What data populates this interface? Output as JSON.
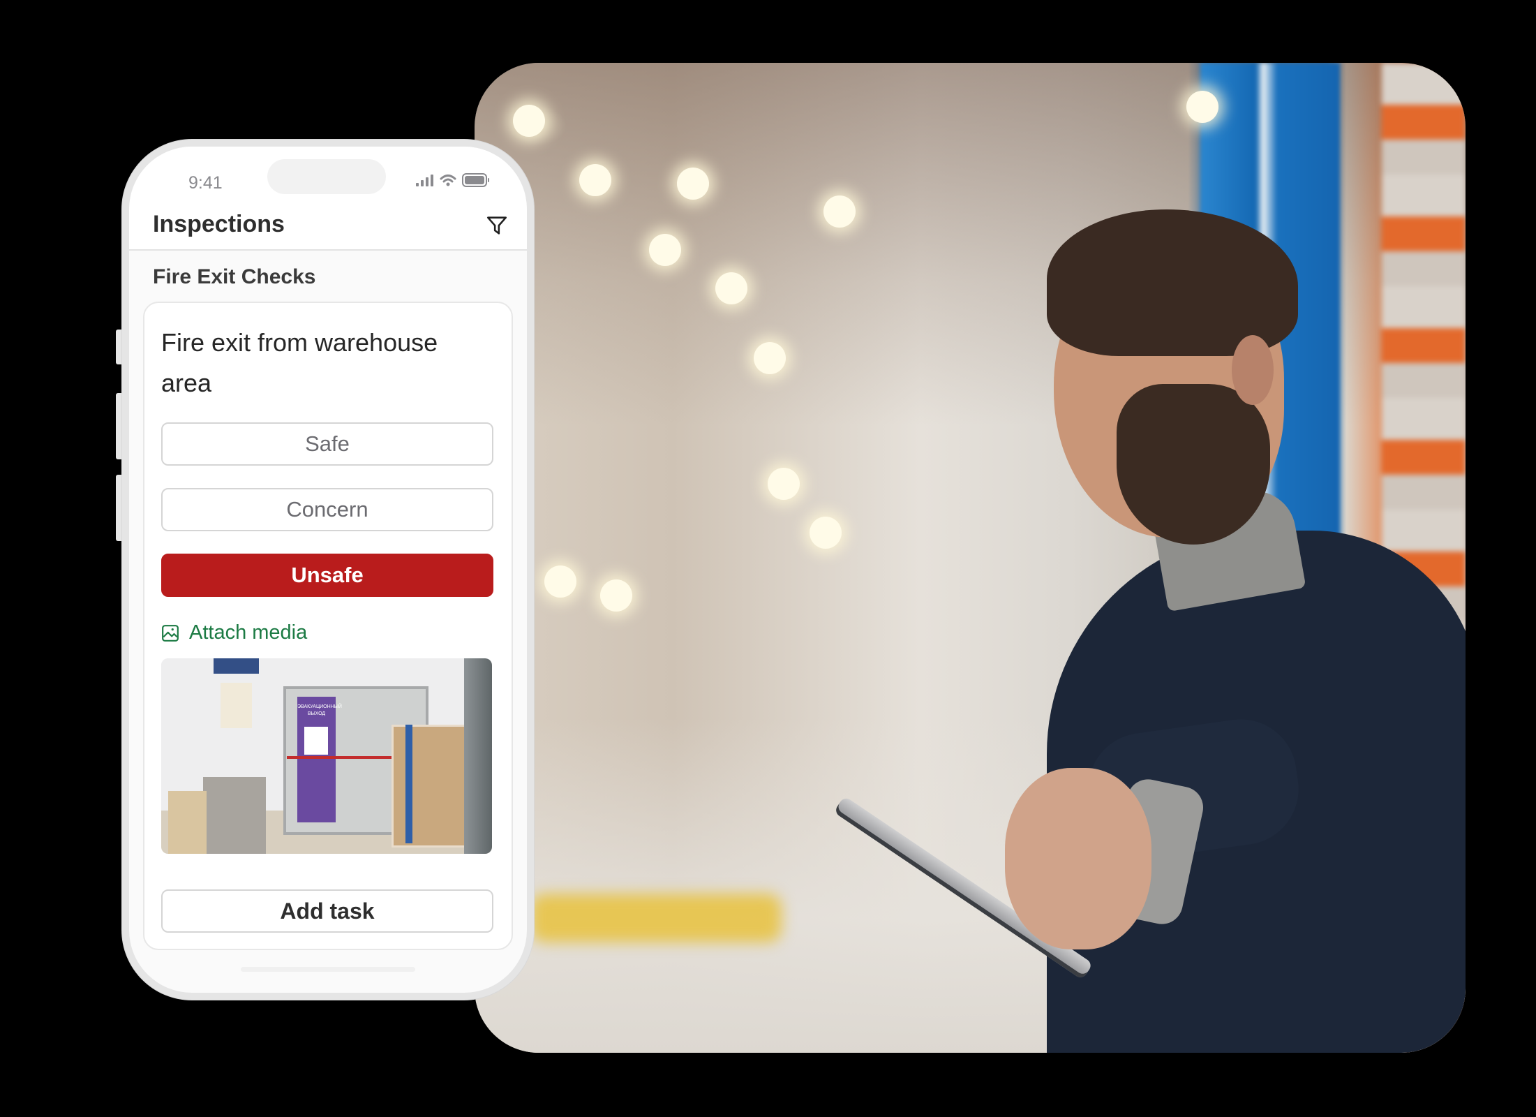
{
  "phone": {
    "status_bar": {
      "time": "9:41",
      "icons": [
        "cellular-signal-icon",
        "wifi-icon",
        "battery-icon"
      ]
    },
    "header": {
      "title": "Inspections",
      "filter_icon": "filter-funnel-icon"
    },
    "section_title": "Fire Exit Checks",
    "inspection_item": {
      "title": "Fire exit from warehouse area",
      "options": [
        {
          "label": "Safe",
          "selected": false
        },
        {
          "label": "Concern",
          "selected": false
        },
        {
          "label": "Unsafe",
          "selected": true
        }
      ],
      "attach_media_label": "Attach media",
      "attached_photo": {
        "description": "Fire exit door with purple evacuation sign",
        "sign_text": "ЭВАКУАЦИОННЫЙ ВЫХОД"
      },
      "add_task_label": "Add task"
    }
  },
  "colors": {
    "unsafe_red": "#B91C1C",
    "attach_green": "#1B7A43",
    "background": "#000000"
  },
  "background_photo": {
    "description": "Bearded man in navy sweater using a tablet in a warehouse aisle"
  }
}
